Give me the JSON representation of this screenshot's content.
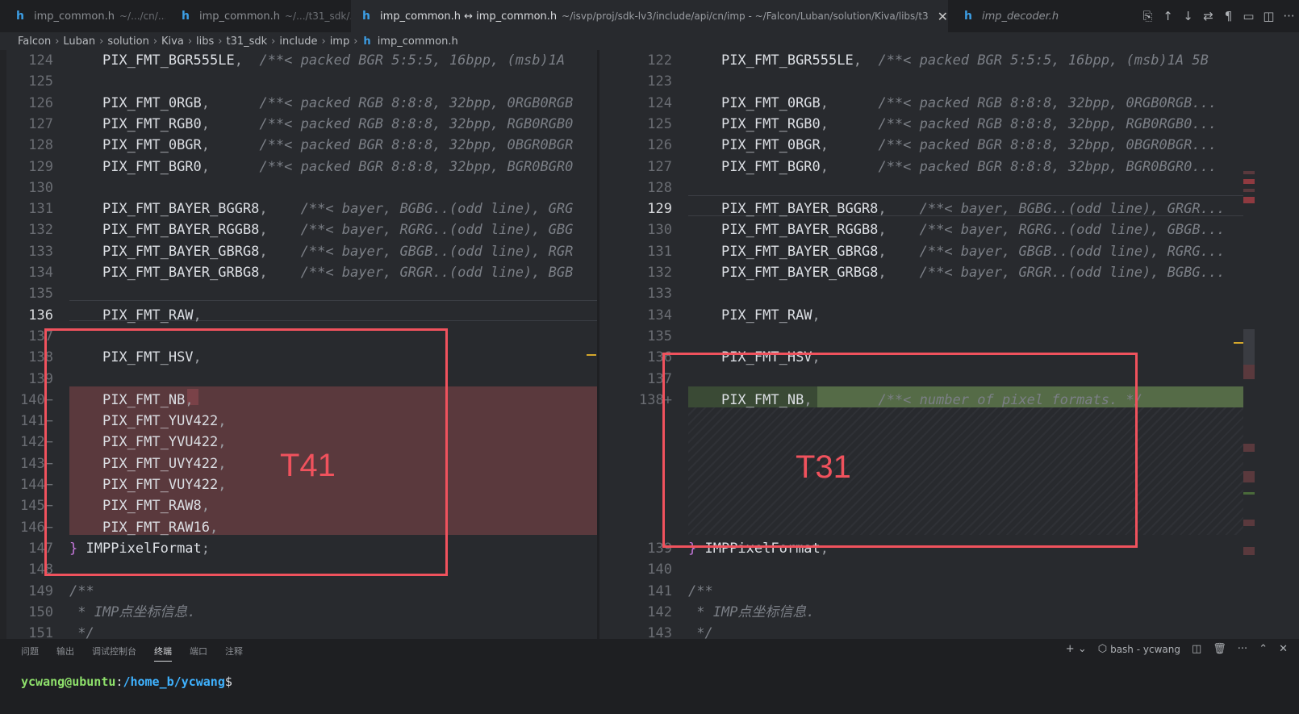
{
  "tabs": [
    {
      "icon": "h",
      "title": "imp_common.h",
      "desc": "~/.../cn/..."
    },
    {
      "icon": "h",
      "title": "imp_common.h",
      "desc": "~/.../t31_sdk/..."
    },
    {
      "icon": "h",
      "title": "imp_common.h ↔ imp_common.h",
      "desc": "~/isvp/proj/sdk-lv3/include/api/cn/imp - ~/Falcon/Luban/solution/Kiva/libs/t31_sdk/include/imp",
      "close": "✕"
    },
    {
      "icon": "h",
      "title": "imp_decoder.h",
      "desc": ""
    }
  ],
  "breadcrumb": [
    "Falcon",
    "Luban",
    "solution",
    "Kiva",
    "libs",
    "t31_sdk",
    "include",
    "imp",
    "imp_common.h"
  ],
  "left_lines": [
    {
      "n": "124",
      "code": "PIX_FMT_BGR555LE,",
      "pad": "  ",
      "comment": "/**< packed BGR 5:5:5, 16bpp, (msb)1A"
    },
    {
      "n": "125",
      "code": "",
      "comment": ""
    },
    {
      "n": "126",
      "code": "PIX_FMT_0RGB,",
      "pad": "      ",
      "comment": "/**< packed RGB 8:8:8, 32bpp, 0RGB0RGB"
    },
    {
      "n": "127",
      "code": "PIX_FMT_RGB0,",
      "pad": "      ",
      "comment": "/**< packed RGB 8:8:8, 32bpp, RGB0RGB0"
    },
    {
      "n": "128",
      "code": "PIX_FMT_0BGR,",
      "pad": "      ",
      "comment": "/**< packed BGR 8:8:8, 32bpp, 0BGR0BGR"
    },
    {
      "n": "129",
      "code": "PIX_FMT_BGR0,",
      "pad": "      ",
      "comment": "/**< packed BGR 8:8:8, 32bpp, BGR0BGR0"
    },
    {
      "n": "130",
      "code": "",
      "comment": ""
    },
    {
      "n": "131",
      "code": "PIX_FMT_BAYER_BGGR8,",
      "pad": "    ",
      "comment": "/**< bayer, BGBG..(odd line), GRG"
    },
    {
      "n": "132",
      "code": "PIX_FMT_BAYER_RGGB8,",
      "pad": "    ",
      "comment": "/**< bayer, RGRG..(odd line), GBG"
    },
    {
      "n": "133",
      "code": "PIX_FMT_BAYER_GBRG8,",
      "pad": "    ",
      "comment": "/**< bayer, GBGB..(odd line), RGR"
    },
    {
      "n": "134",
      "code": "PIX_FMT_BAYER_GRBG8,",
      "pad": "    ",
      "comment": "/**< bayer, GRGR..(odd line), BGB"
    },
    {
      "n": "135",
      "code": "",
      "comment": ""
    },
    {
      "n": "136",
      "code": "PIX_FMT_RAW,",
      "comment": ""
    },
    {
      "n": "137",
      "code": "",
      "comment": ""
    },
    {
      "n": "138",
      "code": "PIX_FMT_HSV,",
      "comment": ""
    },
    {
      "n": "139",
      "code": "",
      "comment": ""
    },
    {
      "n": "140−",
      "code": "PIX_FMT_NB,",
      "comment": ""
    },
    {
      "n": "141−",
      "code": "PIX_FMT_YUV422,",
      "comment": ""
    },
    {
      "n": "142−",
      "code": "PIX_FMT_YVU422,",
      "comment": ""
    },
    {
      "n": "143−",
      "code": "PIX_FMT_UVY422,",
      "comment": ""
    },
    {
      "n": "144−",
      "code": "PIX_FMT_VUY422,",
      "comment": ""
    },
    {
      "n": "145−",
      "code": "PIX_FMT_RAW8,",
      "comment": ""
    },
    {
      "n": "146−",
      "code": "PIX_FMT_RAW16,",
      "comment": ""
    },
    {
      "n": "147",
      "code": "} IMPPixelFormat;",
      "comment": ""
    },
    {
      "n": "148",
      "code": "",
      "comment": ""
    },
    {
      "n": "149",
      "code": "/**",
      "comment": ""
    },
    {
      "n": "150",
      "code": " * IMP点坐标信息.",
      "comment": ""
    },
    {
      "n": "151",
      "code": " */",
      "comment": ""
    }
  ],
  "right_lines": [
    {
      "n": "122",
      "code": "PIX_FMT_BGR555LE,",
      "pad": "  ",
      "comment": "/**< packed BGR 5:5:5, 16bpp, (msb)1A 5B"
    },
    {
      "n": "123",
      "code": "",
      "comment": ""
    },
    {
      "n": "124",
      "code": "PIX_FMT_0RGB,",
      "pad": "      ",
      "comment": "/**< packed RGB 8:8:8, 32bpp, 0RGB0RGB..."
    },
    {
      "n": "125",
      "code": "PIX_FMT_RGB0,",
      "pad": "      ",
      "comment": "/**< packed RGB 8:8:8, 32bpp, RGB0RGB0..."
    },
    {
      "n": "126",
      "code": "PIX_FMT_0BGR,",
      "pad": "      ",
      "comment": "/**< packed BGR 8:8:8, 32bpp, 0BGR0BGR..."
    },
    {
      "n": "127",
      "code": "PIX_FMT_BGR0,",
      "pad": "      ",
      "comment": "/**< packed BGR 8:8:8, 32bpp, BGR0BGR0..."
    },
    {
      "n": "128",
      "code": "",
      "comment": ""
    },
    {
      "n": "129",
      "code": "PIX_FMT_BAYER_BGGR8,",
      "pad": "    ",
      "comment": "/**< bayer, BGBG..(odd line), GRGR..."
    },
    {
      "n": "130",
      "code": "PIX_FMT_BAYER_RGGB8,",
      "pad": "    ",
      "comment": "/**< bayer, RGRG..(odd line), GBGB..."
    },
    {
      "n": "131",
      "code": "PIX_FMT_BAYER_GBRG8,",
      "pad": "    ",
      "comment": "/**< bayer, GBGB..(odd line), RGRG..."
    },
    {
      "n": "132",
      "code": "PIX_FMT_BAYER_GRBG8,",
      "pad": "    ",
      "comment": "/**< bayer, GRGR..(odd line), BGBG..."
    },
    {
      "n": "133",
      "code": "",
      "comment": ""
    },
    {
      "n": "134",
      "code": "PIX_FMT_RAW,",
      "comment": ""
    },
    {
      "n": "135",
      "code": "",
      "comment": ""
    },
    {
      "n": "136",
      "code": "PIX_FMT_HSV,",
      "comment": ""
    },
    {
      "n": "137",
      "code": "",
      "comment": ""
    },
    {
      "n": "138+",
      "code": "PIX_FMT_NB,",
      "pad": "        ",
      "comment": "/**< number of pixel formats. */"
    },
    {
      "n": "",
      "code": "",
      "comment": ""
    },
    {
      "n": "",
      "code": "",
      "comment": ""
    },
    {
      "n": "",
      "code": "",
      "comment": ""
    },
    {
      "n": "",
      "code": "",
      "comment": ""
    },
    {
      "n": "",
      "code": "",
      "comment": ""
    },
    {
      "n": "",
      "code": "",
      "comment": ""
    },
    {
      "n": "139",
      "code": "} IMPPixelFormat;",
      "comment": ""
    },
    {
      "n": "140",
      "code": "",
      "comment": ""
    },
    {
      "n": "141",
      "code": "/**",
      "comment": ""
    },
    {
      "n": "142",
      "code": " * IMP点坐标信息.",
      "comment": ""
    },
    {
      "n": "143",
      "code": " */",
      "comment": ""
    }
  ],
  "annotations": {
    "left": "T41",
    "right": "T31"
  },
  "panel": {
    "tabs": [
      "问题",
      "输出",
      "调试控制台",
      "终端",
      "端口",
      "注释"
    ],
    "active_tab": "终端",
    "terminal_name": "bash - ycwang",
    "prompt_user": "ycwang@ubuntu",
    "prompt_path": "/home_b/ycwang",
    "prompt_sign": "$"
  },
  "colors": {
    "annotation": "#f0525d",
    "removed": "#5a393d",
    "added": "#556b47",
    "accent": "#3c9ee5"
  }
}
